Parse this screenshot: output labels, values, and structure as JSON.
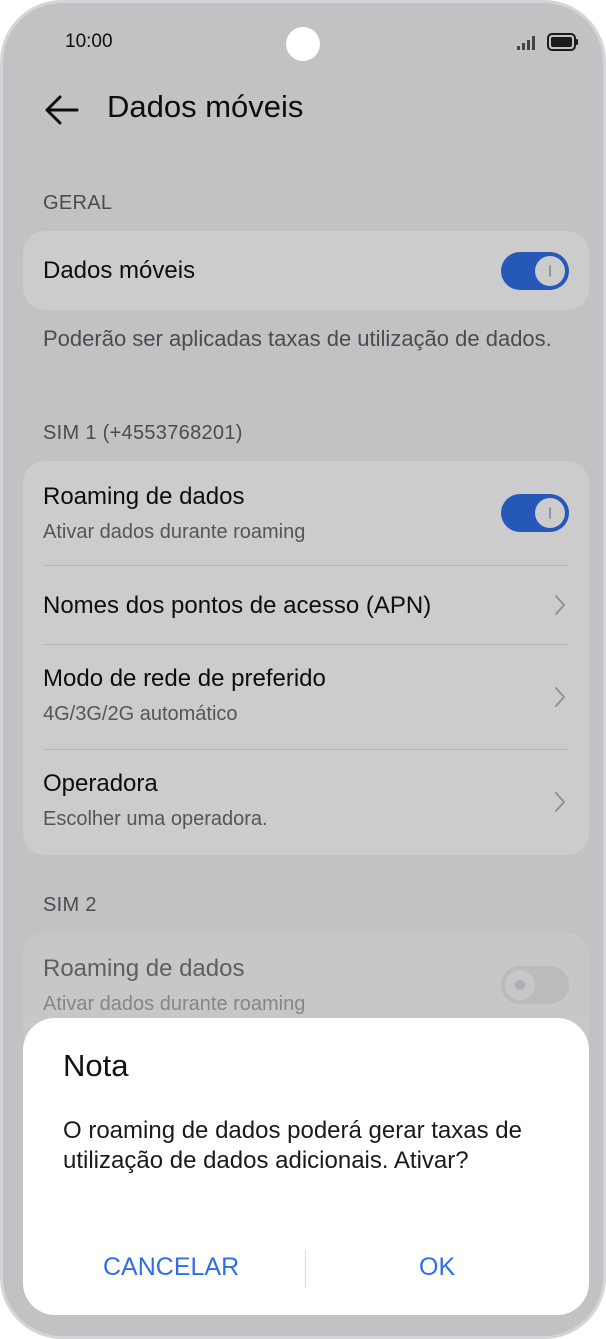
{
  "status": {
    "time": "10:00"
  },
  "header": {
    "title": "Dados móveis"
  },
  "sections": {
    "general": "GERAL",
    "sim1": "SIM 1 (+4553768201)",
    "sim2": "SIM 2"
  },
  "general_card": {
    "mobile_data": {
      "title": "Dados móveis",
      "enabled": true
    }
  },
  "general_note": "Poderão ser aplicadas taxas de utilização de dados.",
  "sim1_card": {
    "roaming": {
      "title": "Roaming de dados",
      "subtitle": "Ativar dados durante roaming",
      "enabled": true
    },
    "apn": {
      "title": "Nomes dos pontos de acesso (APN)"
    },
    "network_mode": {
      "title": "Modo de rede de preferido",
      "subtitle": "4G/3G/2G automático"
    },
    "operator": {
      "title": "Operadora",
      "subtitle": "Escolher uma operadora."
    }
  },
  "sim2_card": {
    "roaming": {
      "title": "Roaming de dados",
      "subtitle": "Ativar dados durante roaming",
      "enabled": false
    }
  },
  "dialog": {
    "title": "Nota",
    "body": "O roaming de dados poderá gerar taxas de utilização de dados adicionais. Ativar?",
    "cancel": "CANCELAR",
    "ok": "OK"
  },
  "colors": {
    "accent": "#2f6fe6",
    "background": "#f1f3f5",
    "card": "#ffffff"
  }
}
